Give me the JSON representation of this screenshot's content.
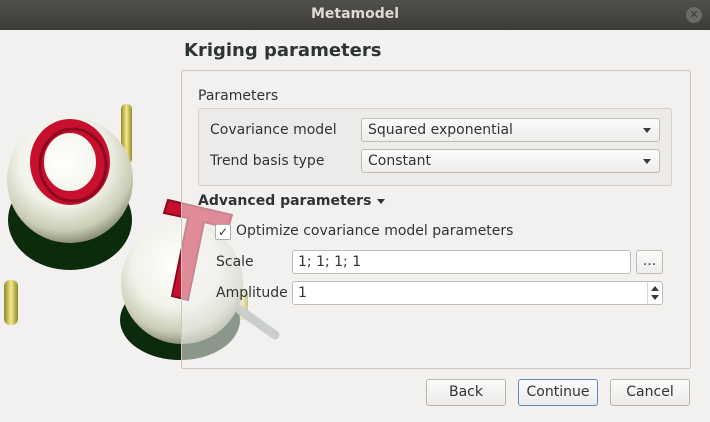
{
  "window": {
    "title": "Metamodel",
    "close_icon": "close-icon"
  },
  "page": {
    "title": "Kriging parameters"
  },
  "parameters": {
    "group_title": "Parameters",
    "covariance_model": {
      "label": "Covariance model",
      "value": "Squared exponential"
    },
    "trend_basis": {
      "label": "Trend basis type",
      "value": "Constant"
    }
  },
  "advanced": {
    "title": "Advanced parameters",
    "optimize": {
      "label": "Optimize covariance model parameters",
      "checked": true,
      "check_glyph": "✓"
    },
    "scale": {
      "label": "Scale",
      "value": "1; 1; 1; 1",
      "browse_label": "..."
    },
    "amplitude": {
      "label": "Amplitude",
      "value": "1"
    }
  },
  "buttons": {
    "back": "Back",
    "continue": "Continue",
    "cancel": "Cancel"
  },
  "colors": {
    "accent_red": "#c8102e",
    "titlebar": "#3d3c38",
    "background": "#f2f1f0"
  }
}
